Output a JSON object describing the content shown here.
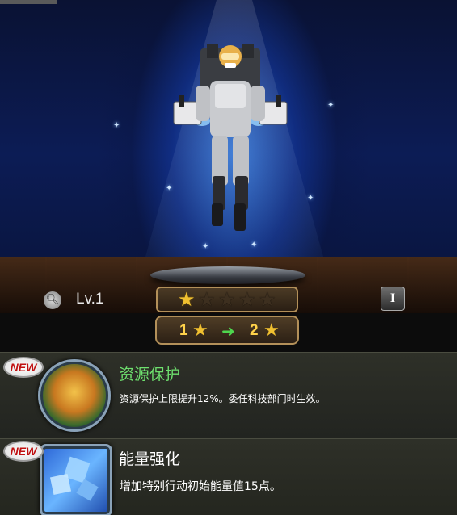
{
  "hero": {
    "level_label": "Lv.1",
    "stars_total": 5,
    "stars_filled": 1
  },
  "upgrade": {
    "from_value": "1",
    "to_value": "2"
  },
  "skills": [
    {
      "badge": "NEW",
      "name": "资源保护",
      "name_color": "#6ee06e",
      "description": "资源保护上限提升12%。委任科技部门时生效。"
    },
    {
      "badge": "NEW",
      "name": "能量强化",
      "name_color": "#ffffff",
      "description": "增加特别行动初始能量值15点。"
    }
  ],
  "icons": {
    "magnify": "magnify-icon",
    "info": "info-icon",
    "star": "star-icon",
    "arrow": "arrow-right-icon"
  },
  "colors": {
    "star_on": "#f0c030",
    "arrow": "#4ed64e",
    "badge_text": "#c01010"
  }
}
